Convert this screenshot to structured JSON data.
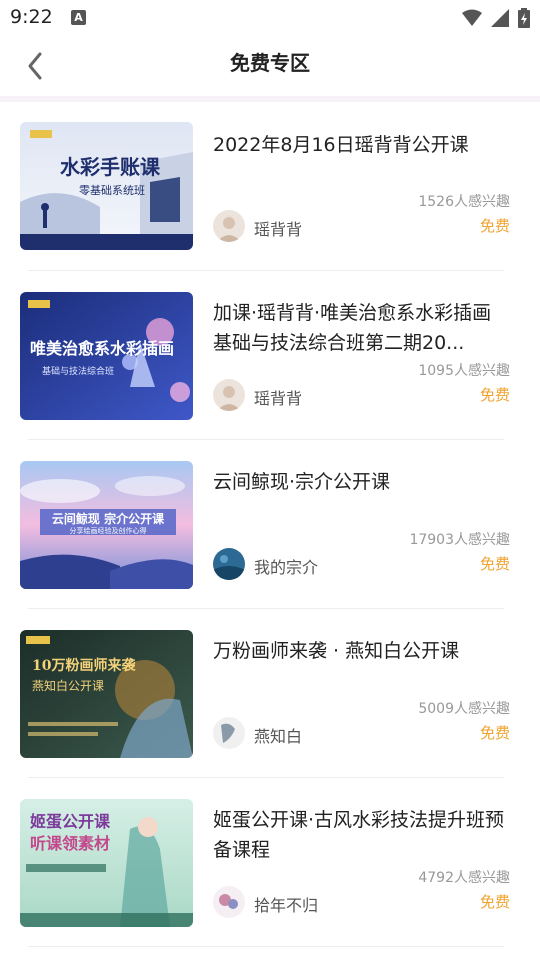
{
  "status_bar": {
    "time": "9:22",
    "notification_letter": "A"
  },
  "header": {
    "title": "免费专区"
  },
  "courses": [
    {
      "title": "2022年8月16日瑶背背公开课",
      "interest": "1526人感兴趣",
      "price": "免费",
      "author": "瑶背背"
    },
    {
      "title": "加课·瑶背背·唯美治愈系水彩插画基础与技法综合班第二期20...",
      "interest": "1095人感兴趣",
      "price": "免费",
      "author": "瑶背背"
    },
    {
      "title": "云间鲸现·宗介公开课",
      "interest": "17903人感兴趣",
      "price": "免费",
      "author": "我的宗介"
    },
    {
      "title": "万粉画师来袭 · 燕知白公开课",
      "interest": "5009人感兴趣",
      "price": "免费",
      "author": "燕知白"
    },
    {
      "title": "姬蛋公开课·古风水彩技法提升班预备课程",
      "interest": "4792人感兴趣",
      "price": "免费",
      "author": "拾年不归"
    }
  ],
  "thumbnails": [
    {
      "headline": "水彩手账课",
      "subline": "零基础系统班"
    },
    {
      "headline": "唯美治愈系水彩插画",
      "subline": "基础与技法综合班"
    },
    {
      "headline": "云间鲸现 宗介公开课",
      "subline": "分享绘画经验及创作心得"
    },
    {
      "headline": "10万粉画师来袭",
      "subline": "燕知白公开课"
    },
    {
      "headline": "姬蛋公开课",
      "subline": "听课领素材"
    }
  ]
}
